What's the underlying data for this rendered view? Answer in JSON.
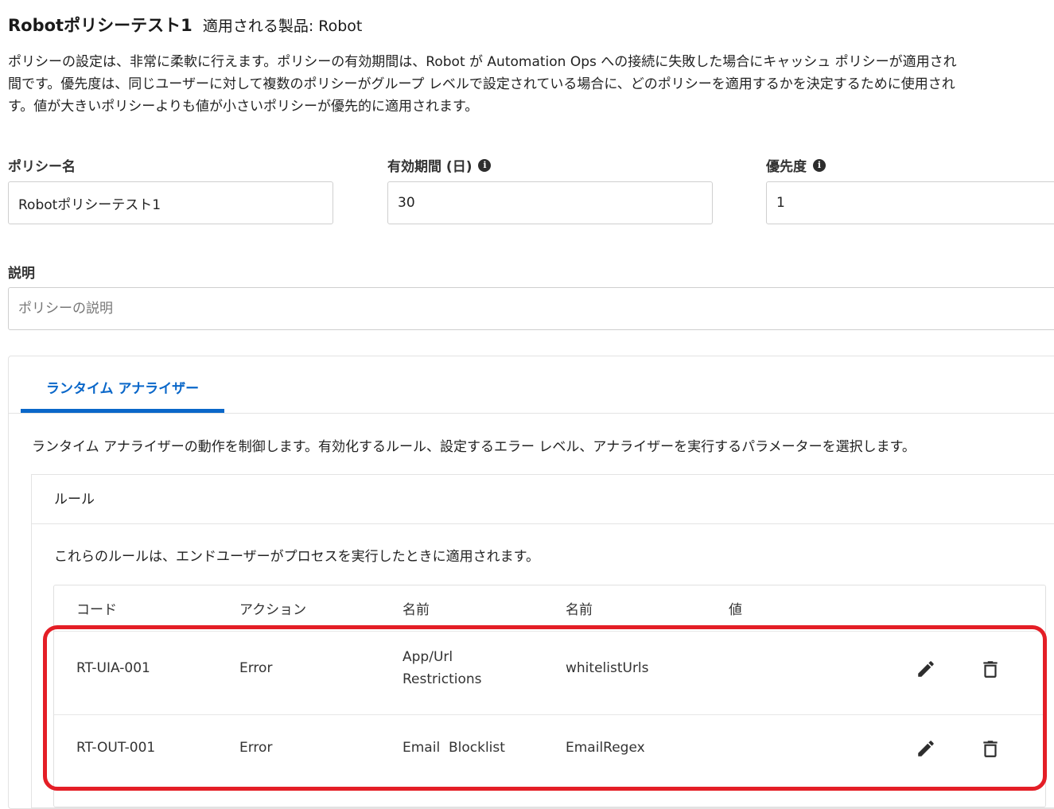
{
  "header": {
    "title": "Robotポリシーテスト1",
    "product_label": "適用される製品: Robot"
  },
  "description": "ポリシーの設定は、非常に柔軟に行えます。ポリシーの有効期間は、Robot が Automation Ops への接続に失敗した場合にキャッシュ ポリシーが適用され\n間です。優先度は、同じユーザーに対して複数のポリシーがグループ レベルで設定されている場合に、どのポリシーを適用するかを決定するために使用され\nす。値が大きいポリシーよりも値が小さいポリシーが優先的に適用されます。",
  "form": {
    "policy_name_label": "ポリシー名",
    "policy_name_value": "Robotポリシーテスト1",
    "validity_label": "有効期間 (日)",
    "validity_value": "30",
    "priority_label": "優先度",
    "priority_value": "1",
    "description_label": "説明",
    "description_placeholder": "ポリシーの説明",
    "info_icon": "info-icon"
  },
  "tabs": [
    {
      "label": "ランタイム アナライザー",
      "active": true
    }
  ],
  "tab_description": "ランタイム アナライザーの動作を制御します。有効化するルール、設定するエラー レベル、アナライザーを実行するパラメーターを選択します。",
  "rules": {
    "title": "ルール",
    "description": "これらのルールは、エンドユーザーがプロセスを実行したときに適用されます。",
    "columns": [
      "コード",
      "アクション",
      "名前",
      "名前",
      "値"
    ],
    "rows": [
      {
        "code": "RT-UIA-001",
        "action": "Error",
        "rule_name": "App/Url Restrictions",
        "param_name": "whitelistUrls",
        "value": ""
      },
      {
        "code": "RT-OUT-001",
        "action": "Error",
        "rule_name": "Email  Blocklist",
        "param_name": "EmailRegex",
        "value": ""
      }
    ]
  },
  "colors": {
    "accent": "#0a67c9",
    "highlight": "#e41e26"
  }
}
